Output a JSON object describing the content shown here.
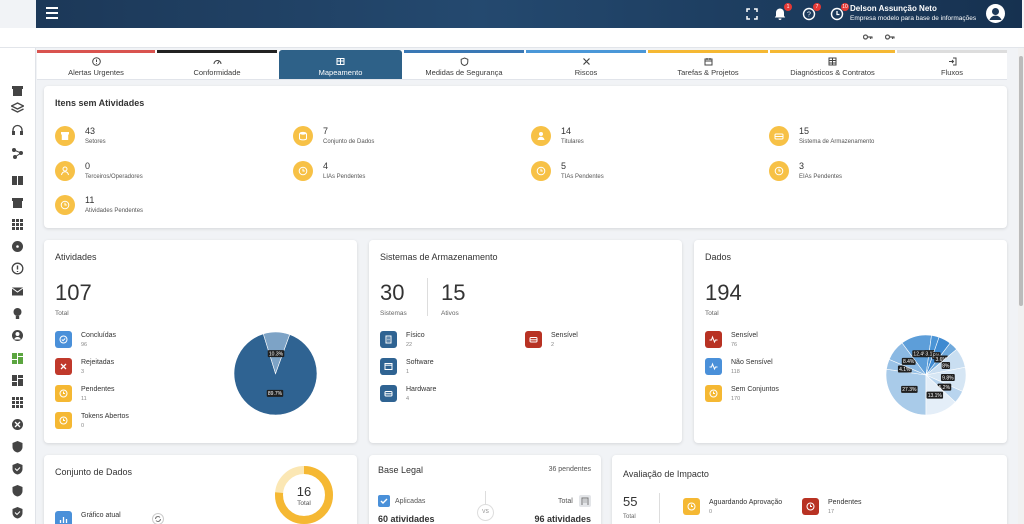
{
  "header": {
    "user_name": "Delson Assunção Neto",
    "company": "Empresa modelo para base de informações",
    "notifications": [
      "1",
      "7",
      "10"
    ]
  },
  "tabs": [
    {
      "label": "Alertas Urgentes",
      "color": "#d9534f"
    },
    {
      "label": "Conformidade",
      "color": "#222222"
    },
    {
      "label": "Mapeamento",
      "color": "#2e6188"
    },
    {
      "label": "Medidas de Segurança",
      "color": "#3a78b5"
    },
    {
      "label": "Riscos",
      "color": "#4a97d8"
    },
    {
      "label": "Tarefas & Projetos",
      "color": "#f5b833"
    },
    {
      "label": "Diagnósticos & Contratos",
      "color": "#f5b833"
    },
    {
      "label": "Fluxos",
      "color": "#dddddd"
    }
  ],
  "itens": {
    "title": "Itens sem Atividades",
    "stats": [
      {
        "value": "43",
        "label": "Setores"
      },
      {
        "value": "7",
        "label": "Conjunto de Dados"
      },
      {
        "value": "14",
        "label": "Titulares"
      },
      {
        "value": "15",
        "label": "Sistema de Armazenamento"
      },
      {
        "value": "0",
        "label": "Terceiros/Operadores"
      },
      {
        "value": "4",
        "label": "LIAs Pendentes"
      },
      {
        "value": "5",
        "label": "TIAs Pendentes"
      },
      {
        "value": "3",
        "label": "EIAs Pendentes"
      },
      {
        "value": "11",
        "label": "Atividades Pendentes"
      }
    ]
  },
  "atividades": {
    "title": "Atividades",
    "total": "107",
    "total_label": "Total",
    "legend": [
      {
        "label": "Concluídas",
        "value": "96",
        "color": "#4a90d9"
      },
      {
        "label": "Rejeitadas",
        "value": "3",
        "color": "#c0392b"
      },
      {
        "label": "Pendentes",
        "value": "11",
        "color": "#f5b833"
      },
      {
        "label": "Tokens Abertos",
        "value": "0",
        "color": "#f5b833"
      }
    ],
    "pie": [
      {
        "label": "89.7%",
        "value": 89.7,
        "color": "#2f6392"
      },
      {
        "label": "10.3%",
        "value": 10.3,
        "color": "#7da3c6"
      }
    ]
  },
  "sistemas": {
    "title": "Sistemas de Armazenamento",
    "total": "30",
    "total_label": "Sistemas",
    "ativos": "15",
    "ativos_label": "Ativos",
    "legend": [
      {
        "label": "Físico",
        "value": "22",
        "color": "#2f6392"
      },
      {
        "label": "Sensível",
        "value": "2",
        "color": "#b83223"
      },
      {
        "label": "Software",
        "value": "1",
        "color": "#2f6392"
      },
      {
        "label": "Hardware",
        "value": "4",
        "color": "#2f6392"
      }
    ]
  },
  "dados": {
    "title": "Dados",
    "total": "194",
    "total_label": "Total",
    "legend": [
      {
        "label": "Sensível",
        "value": "76",
        "color": "#b83223"
      },
      {
        "label": "Não Sensível",
        "value": "118",
        "color": "#4a90d9"
      },
      {
        "label": "Sem Conjuntos",
        "value": "170",
        "color": "#f5b833"
      }
    ],
    "pie": [
      {
        "label": "27.3%",
        "value": 27.3,
        "color": "#a9cbe9"
      },
      {
        "label": "4.1%",
        "value": 4.1,
        "color": "#9ac2e6"
      },
      {
        "label": "8.4%",
        "value": 8.4,
        "color": "#8bb9e3"
      },
      {
        "label": "12.4%",
        "value": 12.4,
        "color": "#5d9ed9"
      },
      {
        "label": "3.1%",
        "value": 3.1,
        "color": "#4b94d6"
      },
      {
        "label": "5%",
        "value": 5.0,
        "color": "#3f8ad1"
      },
      {
        "label": "3.6%",
        "value": 3.6,
        "color": "#6fa9dc"
      },
      {
        "label": "8%",
        "value": 8.0,
        "color": "#c9def1"
      },
      {
        "label": "9.8%",
        "value": 9.8,
        "color": "#d6e6f4"
      },
      {
        "label": "5.2%",
        "value": 5.2,
        "color": "#b8d4ee"
      },
      {
        "label": "13.1%",
        "value": 13.1,
        "color": "#e4eef8"
      }
    ]
  },
  "conjunto": {
    "title": "Conjunto de Dados",
    "total": "16",
    "total_label": "Total",
    "chart_label": "Gráfico atual"
  },
  "base_legal": {
    "title": "Base Legal",
    "pendentes": "36 pendentes",
    "aplicadas_label": "Aplicadas",
    "aplicadas_value": "60 atividades",
    "vs": "VS",
    "total_label": "Total",
    "total_value": "96 atividades"
  },
  "avaliacao": {
    "title": "Avaliação de Impacto",
    "total": "55",
    "total_label": "Total",
    "items": [
      {
        "label": "Aguardando Aprovação",
        "value": "0",
        "color": "#f5b833"
      },
      {
        "label": "Pendentes",
        "value": "17",
        "color": "#b83223"
      }
    ]
  }
}
